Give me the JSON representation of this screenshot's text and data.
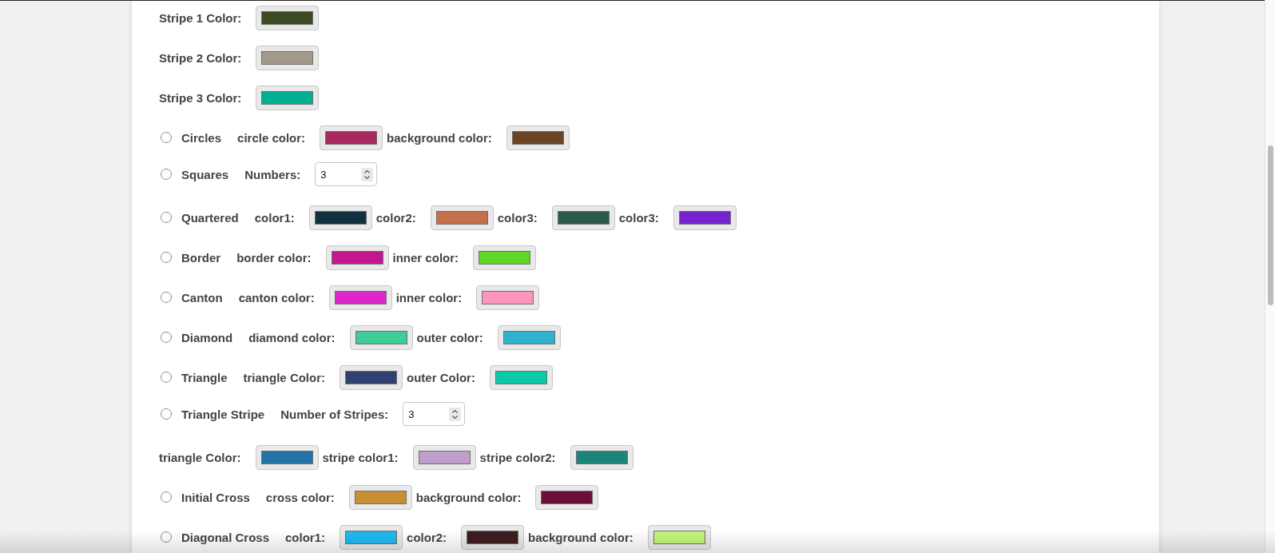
{
  "rows": [
    {
      "kind": "color",
      "label": "Stripe 1 Color:",
      "color": "#3b4a20"
    },
    {
      "kind": "color",
      "label": "Stripe 2 Color:",
      "color": "#a39a8b"
    },
    {
      "kind": "color",
      "label": "Stripe 3 Color:",
      "color": "#00ae90"
    },
    {
      "kind": "option",
      "name": "Circles",
      "selected": false,
      "fields": [
        {
          "kind": "color",
          "label": "circle color:",
          "color": "#a8295e"
        },
        {
          "kind": "color",
          "label": "background color:",
          "color": "#6b4325"
        }
      ]
    },
    {
      "kind": "option",
      "name": "Squares",
      "selected": false,
      "fields": [
        {
          "kind": "number",
          "label": "Numbers:",
          "value": "3"
        }
      ]
    },
    {
      "kind": "option",
      "name": "Quartered",
      "selected": false,
      "fields": [
        {
          "kind": "color",
          "label": "color1:",
          "color": "#12313f"
        },
        {
          "kind": "color",
          "label": "color2:",
          "color": "#c36f4b"
        },
        {
          "kind": "color",
          "label": "color3:",
          "color": "#2b5a4c"
        },
        {
          "kind": "color",
          "label": "color3:",
          "color": "#7524cf"
        }
      ]
    },
    {
      "kind": "option",
      "name": "Border",
      "selected": false,
      "fields": [
        {
          "kind": "color",
          "label": "border color:",
          "color": "#c4168f"
        },
        {
          "kind": "color",
          "label": "inner color:",
          "color": "#62d826"
        }
      ]
    },
    {
      "kind": "option",
      "name": "Canton",
      "selected": false,
      "fields": [
        {
          "kind": "color",
          "label": "canton color:",
          "color": "#dd27c8"
        },
        {
          "kind": "color",
          "label": "inner color:",
          "color": "#fd95bf"
        }
      ]
    },
    {
      "kind": "option",
      "name": "Diamond",
      "selected": false,
      "fields": [
        {
          "kind": "color",
          "label": "diamond color:",
          "color": "#40cc97"
        },
        {
          "kind": "color",
          "label": "outer color:",
          "color": "#2db3cc"
        }
      ]
    },
    {
      "kind": "option",
      "name": "Triangle",
      "selected": false,
      "fields": [
        {
          "kind": "color",
          "label": "triangle Color:",
          "color": "#31416f"
        },
        {
          "kind": "color",
          "label": "outer Color:",
          "color": "#0cc9aa"
        }
      ]
    },
    {
      "kind": "option",
      "name": "Triangle Stripe",
      "selected": false,
      "fields": [
        {
          "kind": "number",
          "label": "Number of Stripes:",
          "value": "3"
        }
      ]
    },
    {
      "kind": "fields",
      "fields": [
        {
          "kind": "color",
          "label": "triangle Color:",
          "color": "#2273a8"
        },
        {
          "kind": "color",
          "label": "stripe color1:",
          "color": "#c09ecb"
        },
        {
          "kind": "color",
          "label": "stripe color2:",
          "color": "#1c857a"
        }
      ]
    },
    {
      "kind": "option",
      "name": "Initial Cross",
      "selected": false,
      "fields": [
        {
          "kind": "color",
          "label": "cross color:",
          "color": "#c89035"
        },
        {
          "kind": "color",
          "label": "background color:",
          "color": "#6c0e3a"
        }
      ]
    },
    {
      "kind": "option",
      "name": "Diagonal Cross",
      "selected": false,
      "fields": [
        {
          "kind": "color",
          "label": "color1:",
          "color": "#22b8f0"
        },
        {
          "kind": "color",
          "label": "color2:",
          "color": "#3f1d20"
        },
        {
          "kind": "color",
          "label": "background color:",
          "color": "#c4f57c"
        }
      ]
    }
  ]
}
